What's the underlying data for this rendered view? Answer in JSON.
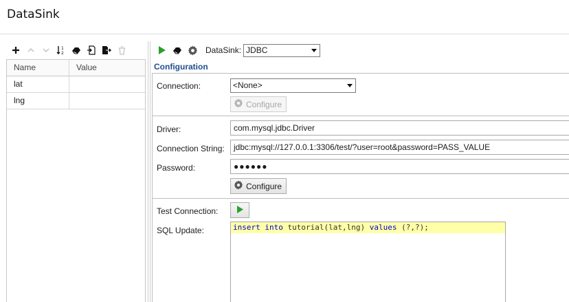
{
  "window": {
    "title": "DataSink"
  },
  "left_toolbar": {
    "icons": [
      "plus-icon",
      "arrow-up-icon",
      "arrow-down-icon",
      "sort-icon",
      "eraser-icon",
      "import-icon",
      "export-icon",
      "trash-icon"
    ]
  },
  "variables_table": {
    "headers": {
      "name": "Name",
      "value": "Value"
    },
    "rows": [
      {
        "name": "lat",
        "value": ""
      },
      {
        "name": "lng",
        "value": ""
      }
    ]
  },
  "right_toolbar": {
    "datasink_label": "DataSink:",
    "datasink_value": "JDBC"
  },
  "config": {
    "section_title": "Configuration",
    "connection_label": "Connection:",
    "connection_value": "<None>",
    "configure_label": "Configure",
    "driver_label": "Driver:",
    "driver_value": "com.mysql.jdbc.Driver",
    "conn_string_label": "Connection String:",
    "conn_string_value": "jdbc:mysql://127.0.0.1:3306/test/?user=root&password=PASS_VALUE",
    "password_label": "Password:",
    "password_value": "●●●●●●",
    "test_connection_label": "Test Connection:",
    "sql_update_label": "SQL Update:",
    "sql": {
      "kw_insert": "insert",
      "kw_into": "into",
      "table": " tutorial(lat,lng) ",
      "kw_values": "values",
      "params": " (?,?);"
    }
  },
  "colors": {
    "accent": "#1f4e8c",
    "play_green": "#2aa02a",
    "sql_highlight": "#ffffa8",
    "keyword": "#0000d0"
  }
}
